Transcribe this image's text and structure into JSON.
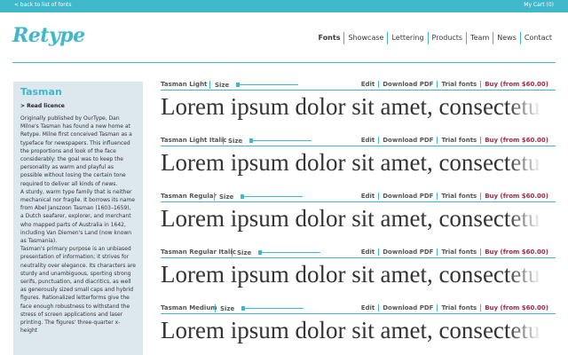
{
  "topbar": {
    "back_link": "< back to list of fonts",
    "cart": "My Cart (0)"
  },
  "logo": "Retype",
  "nav": [
    "Fonts",
    "Showcase",
    "Lettering",
    "Products",
    "Team",
    "News",
    "Contact"
  ],
  "sidebar": {
    "title": "Tasman",
    "read_licence": "> Read licence",
    "paragraphs": [
      "Originally published by OurType, Dan Milne's Tasman has found a new home at Retype. Milne first conceived Tasman as a typeface for newspapers. This influenced the proportions and look of the face considerably: the goal was to keep the personality as warm and playful as possible without losing the certain tone required to deliver all kinds of news.",
      "A sturdy, warm type family that is neither mechanical nor fragile. It borrows its name from Abel Janszoon Tasman (1603–1659), a Dutch seafarer, explorer, and merchant who mapped parts of Australia in 1642, including Van Diemen's Land (now known as Tasmania).",
      "Tasman's primary purpose is an unbiased presentation of information; it strives for neutrality over elegance. Its characters are sturdy and unambiguous, sporting strong serifs, punctuation, and diacritics, as well as generously sized small caps and hybrid figures. Rationalized letterforms give the face enough robustness to withstand the stress of screen applications and laser printing. The figures' three-quarter x-height"
    ]
  },
  "font_rows": [
    {
      "name": "Tasman Light",
      "size_label": "Size",
      "size_level": 0.0
    },
    {
      "name": "Tasman Light Italic",
      "size_label": "Size",
      "size_level": 0.0
    },
    {
      "name": "Tasman Regular",
      "size_label": "Size",
      "size_level": 0.0
    },
    {
      "name": "Tasman Regular Italic",
      "size_label": "Size",
      "size_level": 0.0
    },
    {
      "name": "Tasman Medium",
      "size_label": "Size",
      "size_level": 0.0
    }
  ],
  "row_actions": {
    "edit": "Edit",
    "download_pdf": "Download PDF",
    "trial_fonts": "Trial fonts",
    "buy": "Buy (from $60.00)"
  },
  "sample_text": "Lorem ipsum dolor sit amet, consectetur adipiscing",
  "colors": {
    "accent": "#3fb8cc",
    "buy": "#a0284a",
    "sidebar_bg": "#dde7ee"
  }
}
